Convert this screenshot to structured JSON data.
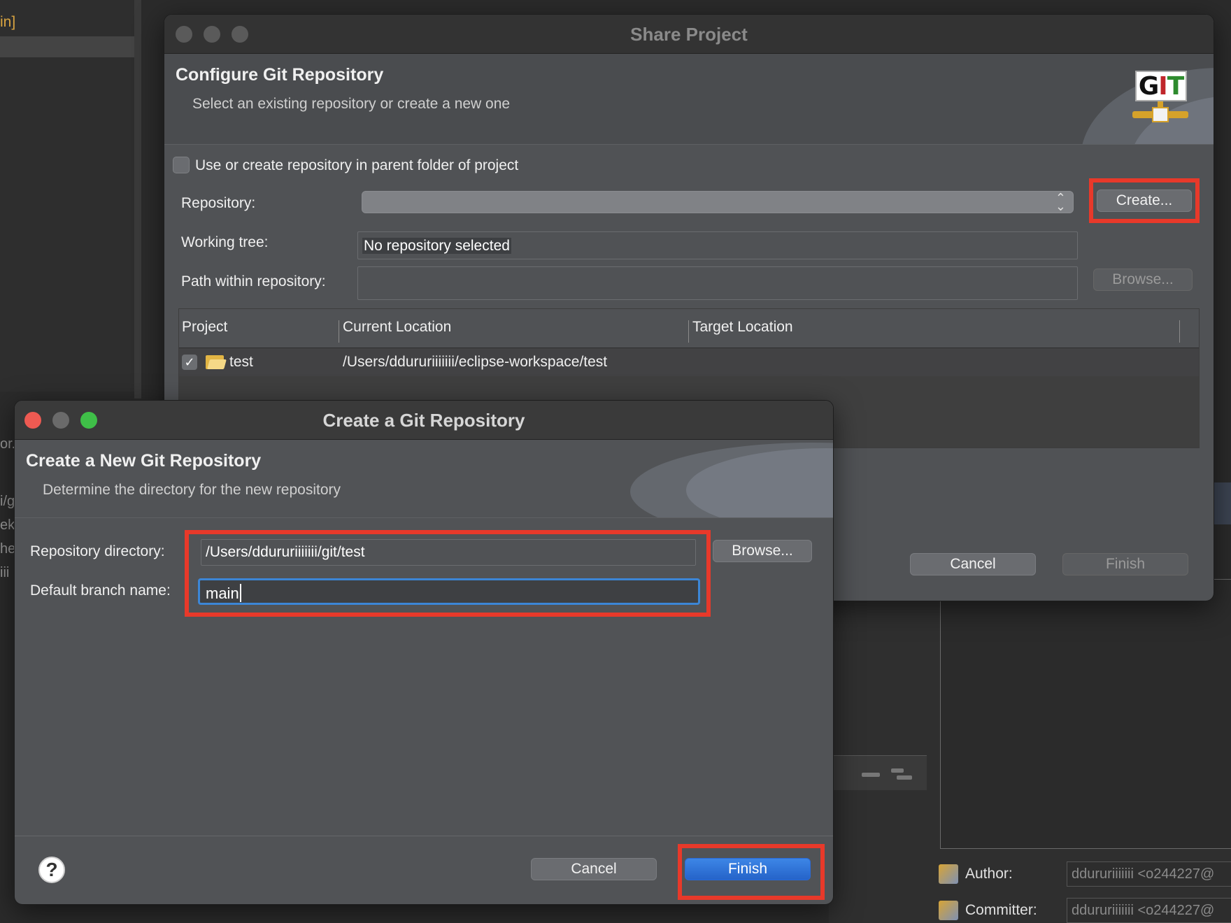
{
  "background": {
    "left_panel_text": "in]",
    "left_fragments": [
      "or..",
      "i/g",
      "ek",
      "he",
      "iii"
    ],
    "author_label": "Author:",
    "author_value": "ddururiiiiiii <o244227@",
    "committer_label": "Committer:",
    "committer_value": "ddururiiiiiii <o244227@"
  },
  "share_project": {
    "title": "Share Project",
    "header_title": "Configure Git Repository",
    "header_subtitle": "Select an existing repository or create a new one",
    "git_logo_text": "GIT",
    "parent_folder_checkbox_label": "Use or create repository in parent folder of project",
    "parent_folder_checked": false,
    "repository_label": "Repository:",
    "repository_value": "",
    "create_button": "Create...",
    "working_tree_label": "Working tree:",
    "working_tree_value": "No repository selected",
    "path_label": "Path within repository:",
    "path_value": "",
    "browse_button": "Browse...",
    "table": {
      "columns": [
        "Project",
        "Current Location",
        "Target Location"
      ],
      "rows": [
        {
          "checked": true,
          "project": "test",
          "current_location": "/Users/ddururiiiiiii/eclipse-workspace/test",
          "target_location": ""
        }
      ]
    },
    "cancel_button": "Cancel",
    "finish_button": "Finish"
  },
  "create_repo": {
    "title": "Create a Git Repository",
    "header_title": "Create a New Git Repository",
    "header_subtitle": "Determine the directory for the new repository",
    "repo_dir_label": "Repository directory:",
    "repo_dir_value": "/Users/ddururiiiiiii/git/test",
    "browse_button": "Browse...",
    "branch_label": "Default branch name:",
    "branch_value": "main",
    "cancel_button": "Cancel",
    "finish_button": "Finish",
    "help_icon": "?"
  },
  "colors": {
    "highlight": "#e8392a",
    "primary_button": "#2563c9",
    "focus_ring": "#3c86d6"
  }
}
